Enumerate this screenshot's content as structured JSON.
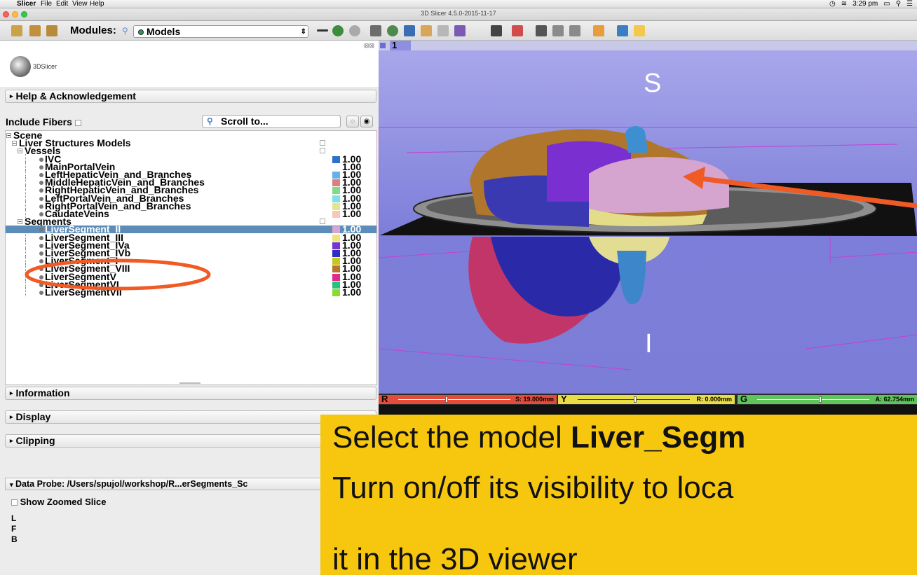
{
  "menubar": {
    "app_name": "Slicer",
    "items": [
      "File",
      "Edit",
      "View",
      "Help"
    ],
    "time": "3:29 pm"
  },
  "window": {
    "title": "3D Slicer 4.5.0-2015-11-17"
  },
  "toolbar": {
    "modules_label": "Modules:",
    "module_selected": "Models"
  },
  "panel": {
    "logo_text": "3DSlicer",
    "help_section": "Help & Acknowledgement",
    "include_fibers_label": "Include Fibers",
    "scroll_to_label": "Scroll to...",
    "sections": {
      "information": "Information",
      "display": "Display",
      "clipping": "Clipping"
    },
    "data_probe": "Data Probe: /Users/spujol/workshop/R...erSegments_Sc",
    "show_zoomed_slice": "Show Zoomed Slice",
    "probe_letters": [
      "L",
      "F",
      "B"
    ]
  },
  "tree": [
    {
      "label": "Scene",
      "level": 0,
      "kind": "expander"
    },
    {
      "label": "Liver Structures Models",
      "level": 1,
      "kind": "expander",
      "checkbox": true
    },
    {
      "label": "Vessels",
      "level": 2,
      "kind": "expander",
      "checkbox": true
    },
    {
      "label": "IVC",
      "level": 3,
      "kind": "leaf",
      "color": "#2a73c9",
      "opacity": "1.00"
    },
    {
      "label": "MainPortalVein",
      "level": 3,
      "kind": "leaf",
      "color": "",
      "opacity": "1.00"
    },
    {
      "label": "LeftHepaticVein_and_Branches",
      "level": 3,
      "kind": "leaf",
      "color": "#6aafe6",
      "opacity": "1.00"
    },
    {
      "label": "MiddleHepaticVein_and_Branches",
      "level": 3,
      "kind": "leaf",
      "color": "#d88080",
      "opacity": "1.00"
    },
    {
      "label": "RightHepaticVein_and_Branches",
      "level": 3,
      "kind": "leaf",
      "color": "#7fdc84",
      "opacity": "1.00"
    },
    {
      "label": "LeftPortalVein_and_Branches",
      "level": 3,
      "kind": "leaf",
      "color": "#7fe2e2",
      "opacity": "1.00"
    },
    {
      "label": "RightPortalVein_and_Branches",
      "level": 3,
      "kind": "leaf",
      "color": "#e9e48a",
      "opacity": "1.00"
    },
    {
      "label": "CaudateVeins",
      "level": 3,
      "kind": "leaf",
      "color": "#f5c8bb",
      "opacity": "1.00"
    },
    {
      "label": "Segments",
      "level": 2,
      "kind": "expander",
      "checkbox": true
    },
    {
      "label": "LiverSegment_II",
      "level": 3,
      "kind": "leaf",
      "color": "#d7a5d4",
      "opacity": "1.00",
      "selected": true
    },
    {
      "label": "LiverSegment_III",
      "level": 3,
      "kind": "leaf",
      "color": "#e9e77c",
      "opacity": "1.00"
    },
    {
      "label": "LiverSegment_IVa",
      "level": 3,
      "kind": "leaf",
      "color": "#7b33cf",
      "opacity": "1.00"
    },
    {
      "label": "LiverSegment_IVb",
      "level": 3,
      "kind": "leaf",
      "color": "#2c2fbf",
      "opacity": "1.00"
    },
    {
      "label": "LiverSegment_I",
      "level": 3,
      "kind": "leaf",
      "color": "#c8c622",
      "opacity": "1.00"
    },
    {
      "label": "LiverSegment_VIII",
      "level": 3,
      "kind": "leaf",
      "color": "#b6762d",
      "opacity": "1.00"
    },
    {
      "label": "LiverSegmentV",
      "level": 3,
      "kind": "leaf",
      "color": "#dc2c8e",
      "opacity": "1.00"
    },
    {
      "label": "LiverSegmentVI",
      "level": 3,
      "kind": "leaf",
      "color": "#27c07c",
      "opacity": "1.00"
    },
    {
      "label": "LiverSegmentVII",
      "level": 3,
      "kind": "leaf",
      "color": "#8fdb2c",
      "opacity": "1.00"
    }
  ],
  "view3d": {
    "layout_number": "1",
    "top_label": "S",
    "bottom_label": "I"
  },
  "slices": [
    {
      "letter": "R",
      "color": "#e34b3a",
      "value": "S: 19.000mm",
      "position": 0.42
    },
    {
      "letter": "Y",
      "color": "#e9dd45",
      "value": "R: 0.000mm",
      "position": 0.5
    },
    {
      "letter": "G",
      "color": "#5ec45b",
      "value": "A: 62.754mm",
      "position": 0.55
    }
  ],
  "overlay": {
    "line1_prefix": "Select the model ",
    "line1_bold": "Liver_Segm",
    "line2": "Turn on/off its visibility to loca",
    "line3": "it in the 3D viewer"
  }
}
